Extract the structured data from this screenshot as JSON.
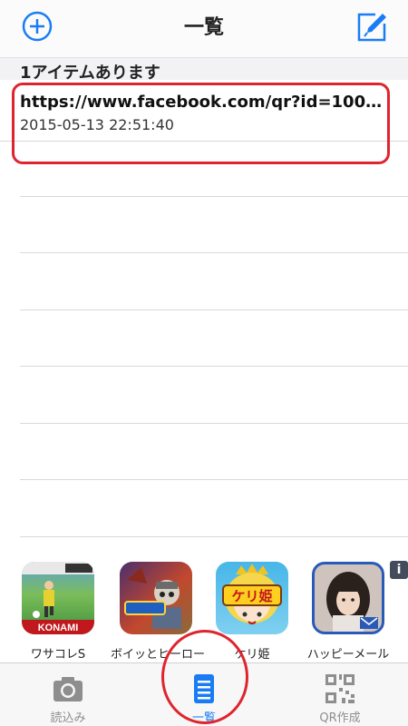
{
  "navbar": {
    "title": "一覧",
    "left_icon": "add-circle-icon",
    "right_icon": "compose-icon",
    "accent": "#1a7cf5"
  },
  "section": {
    "header": "1アイテムあります"
  },
  "items": [
    {
      "title": "https://www.facebook.com/qr?id=100009...",
      "date": "2015-05-13 22:51:40"
    }
  ],
  "ads": [
    {
      "label": "ワサコレS",
      "icon": "soccer-game-icon",
      "brand": "KONAMI"
    },
    {
      "label": "ボイッとヒーロー",
      "icon": "hero-game-icon"
    },
    {
      "label": "ケリ姫",
      "icon": "keri-hime-game-icon",
      "brand": "ケリ姫"
    },
    {
      "label": "ハッピーメール",
      "icon": "happy-mail-app-icon"
    }
  ],
  "ad_info": "i",
  "tabs": [
    {
      "label": "読込み",
      "icon": "camera-icon",
      "active": false
    },
    {
      "label": "一覧",
      "icon": "list-icon",
      "active": true
    },
    {
      "label": "QR作成",
      "icon": "qr-code-icon",
      "active": false
    }
  ],
  "annotation_color": "#e0242e"
}
